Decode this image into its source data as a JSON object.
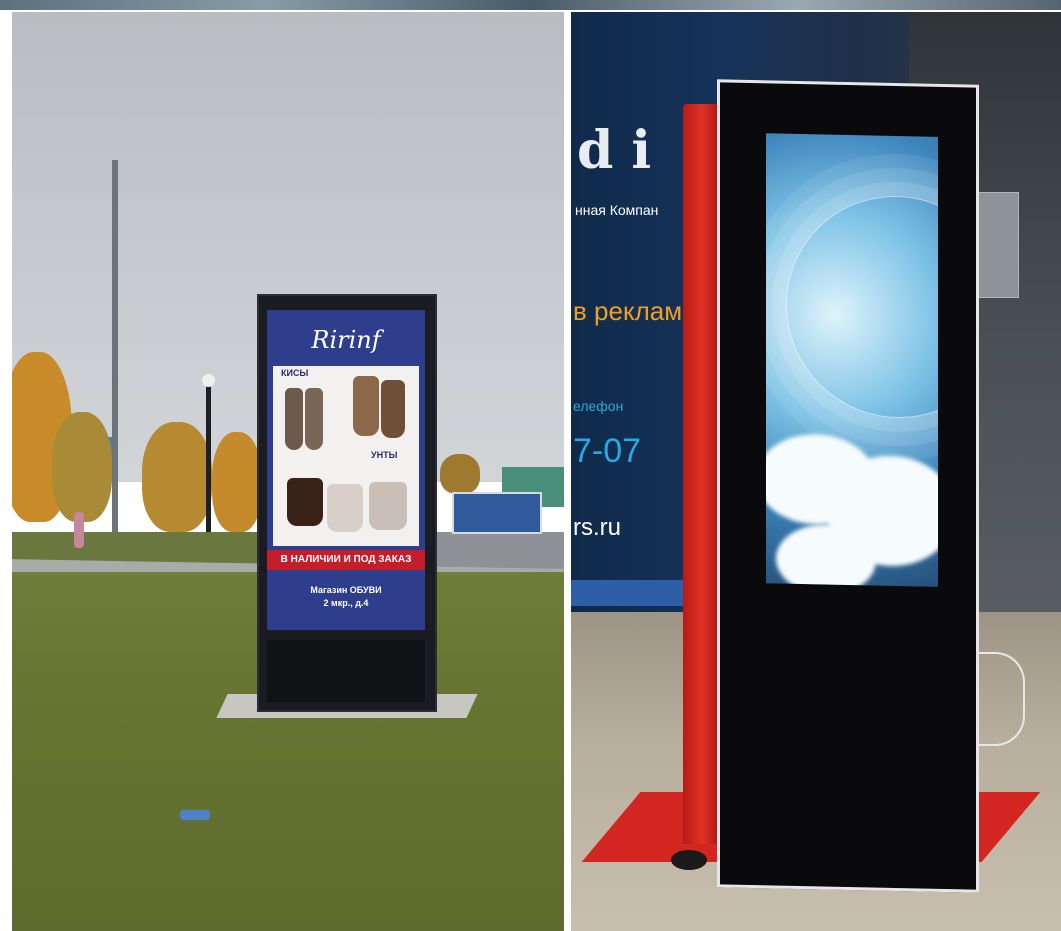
{
  "left_photo": {
    "poster": {
      "brand": "Ririnf",
      "label_1": "КИСЫ",
      "label_2": "УНТЫ",
      "tagline": "В НАЛИЧИИ И ПОД ЗАКАЗ",
      "shop_line1": "Магазин ОБУВИ",
      "shop_line2": "2 мкр., д.4"
    }
  },
  "right_photo": {
    "banner": {
      "letters": "di",
      "line1": "нная Компан",
      "line2": "в реклам",
      "line3": "елефон",
      "line4": "7-07",
      "line5": "rs.ru"
    }
  },
  "colors": {
    "poster_blue": "#2f3e8c",
    "poster_red": "#c41e2a",
    "stand_red": "#d42620"
  }
}
